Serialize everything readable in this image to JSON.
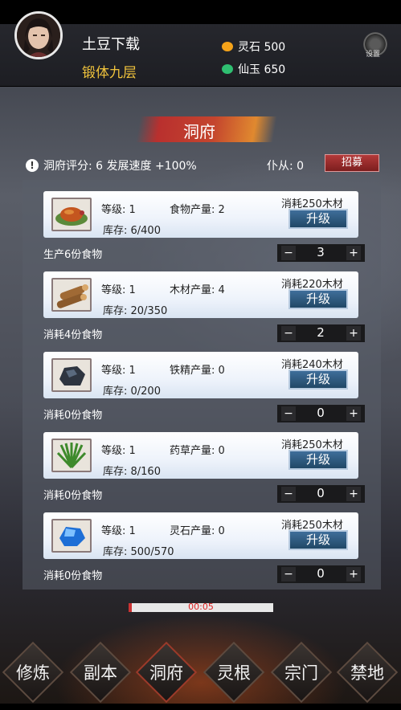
{
  "player": {
    "name": "土豆下载",
    "realm": "锻体九层"
  },
  "resources": [
    {
      "label": "灵石 500",
      "color": "#f5a31a",
      "icon": "spirit-stone-icon"
    },
    {
      "label": "仙玉 650",
      "color": "#2fbf71",
      "icon": "jade-icon"
    }
  ],
  "settings": {
    "label": "设置",
    "icon": "gear-icon"
  },
  "page": {
    "title": "洞府"
  },
  "info": {
    "text": "洞府评分: 6 发展速度 +100%",
    "servant": "仆从: 0",
    "recruit_label": "招募"
  },
  "buildings": [
    {
      "icon": "food-icon",
      "level": "等级: 1",
      "output": "食物产量: 2",
      "stock": "库存: 6/400",
      "cost": "消耗250木材",
      "upgrade": "升级",
      "consume": "生产6份食物",
      "count": "3"
    },
    {
      "icon": "wood-icon",
      "level": "等级: 1",
      "output": "木材产量: 4",
      "stock": "库存: 20/350",
      "cost": "消耗220木材",
      "upgrade": "升级",
      "consume": "消耗4份食物",
      "count": "2"
    },
    {
      "icon": "iron-ore-icon",
      "level": "等级: 1",
      "output": "铁精产量: 0",
      "stock": "库存: 0/200",
      "cost": "消耗240木材",
      "upgrade": "升级",
      "consume": "消耗0份食物",
      "count": "0"
    },
    {
      "icon": "herb-icon",
      "level": "等级: 1",
      "output": "药草产量: 0",
      "stock": "库存: 8/160",
      "cost": "消耗250木材",
      "upgrade": "升级",
      "consume": "消耗0份食物",
      "count": "0"
    },
    {
      "icon": "spirit-crystal-icon",
      "level": "等级: 1",
      "output": "灵石产量: 0",
      "stock": "库存: 500/570",
      "cost": "消耗250木材",
      "upgrade": "升级",
      "consume": "消耗0份食物",
      "count": "0"
    }
  ],
  "stepper": {
    "minus": "−",
    "plus": "+"
  },
  "timer": {
    "text": "00:05",
    "progress": 0.02
  },
  "nav": [
    "修炼",
    "副本",
    "洞府",
    "灵根",
    "宗门",
    "禁地"
  ],
  "nav_active": "洞府"
}
